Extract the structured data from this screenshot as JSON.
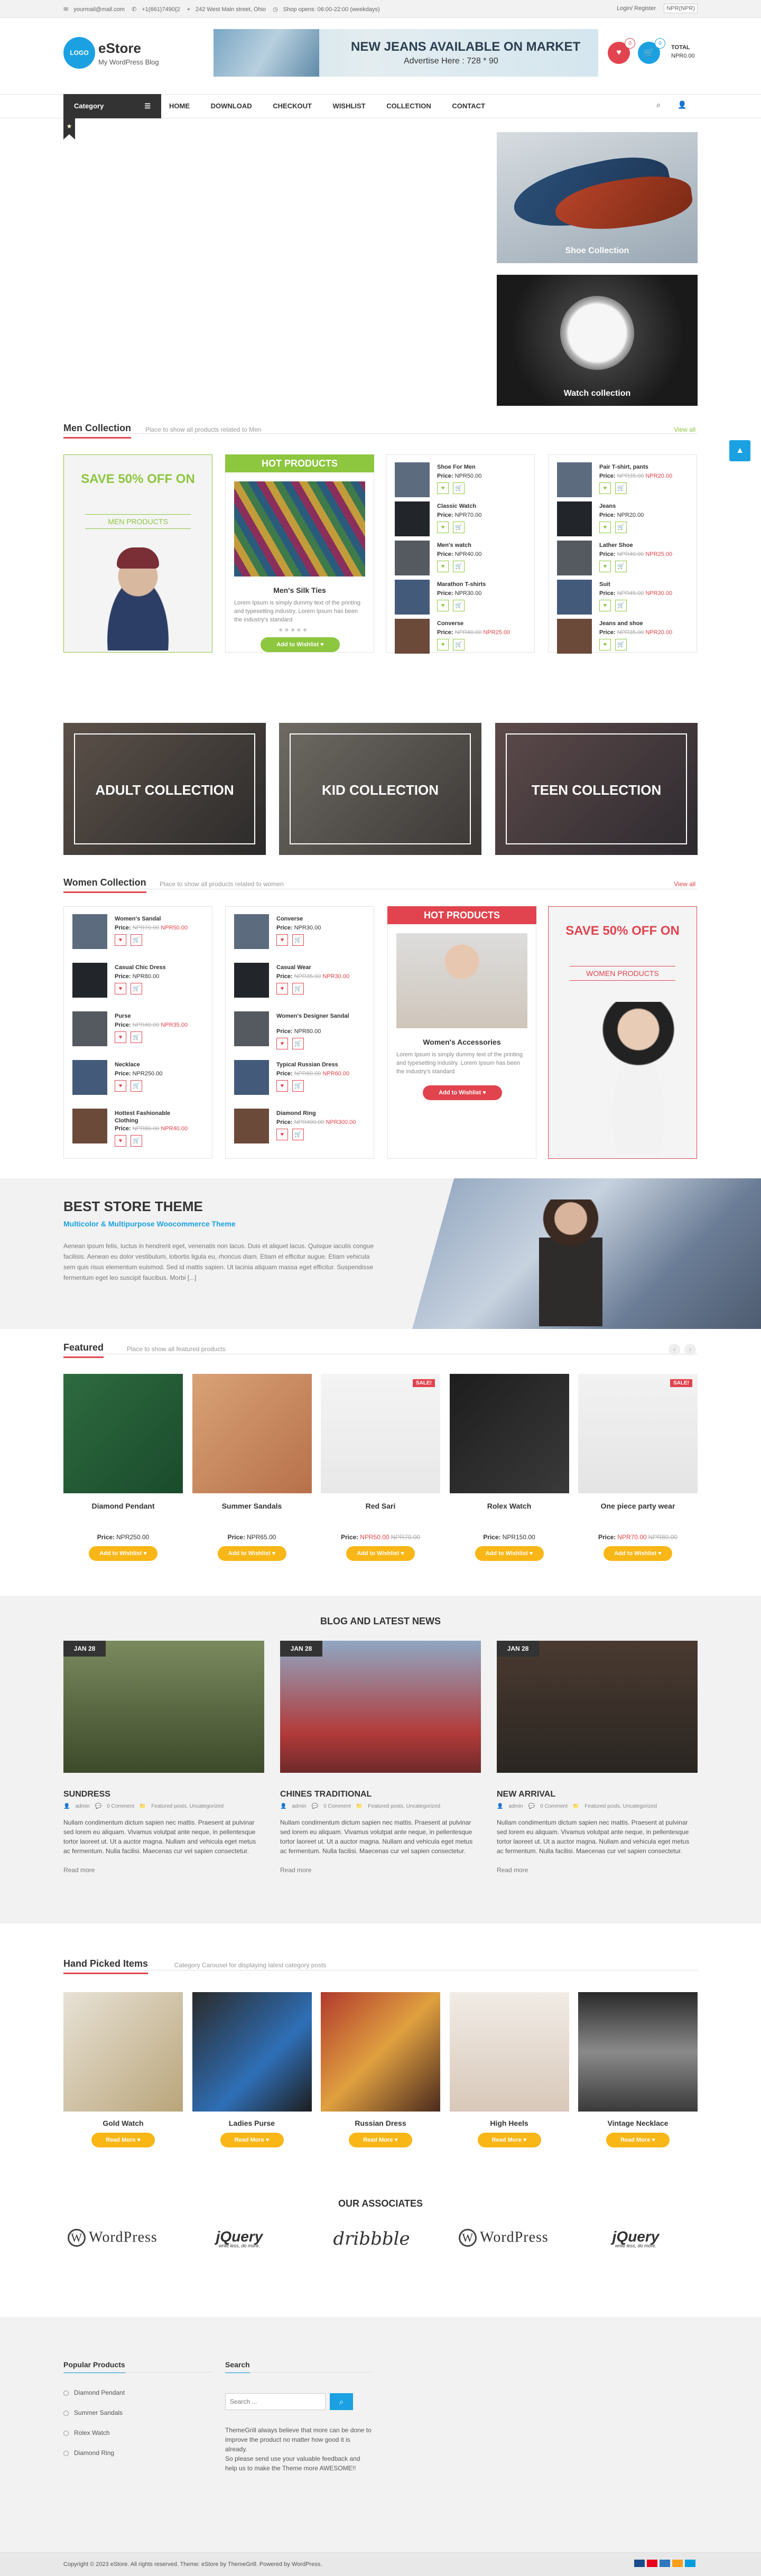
{
  "topbar": {
    "email": "yourmail@mail.com",
    "phone": "+1(661)7490{2",
    "address": "242 West Main street, Ohio",
    "hours": "Shop opens: 06:00-22:00 (weekdays)",
    "login": "Login/ Register",
    "currency": "NPR(NPR)"
  },
  "header": {
    "logo": "LOGO",
    "title": "eStore",
    "tagline": "My WordPress Blog",
    "banner_title": "NEW JEANS AVAILABLE ON MARKET",
    "banner_sub": "Advertise Here : 728 * 90",
    "wishlist_count": "0",
    "cart_count": "0",
    "total_label": "TOTAL",
    "total_value": "NPR0.00"
  },
  "nav": {
    "category": "Category",
    "items": [
      "HOME",
      "DOWNLOAD",
      "CHECKOUT",
      "WISHLIST",
      "COLLECTION",
      "CONTACT"
    ]
  },
  "promos": [
    "Shoe Collection",
    "Watch collection"
  ],
  "men": {
    "title": "Men Collection",
    "subtitle": "Place to show all products related to Men",
    "view_all": "View all",
    "sale_text": "SAVE 50% OFF ON",
    "sale_sub": "MEN PRODUCTS",
    "hot_label": "HOT PRODUCTS",
    "hot_name": "Men's Silk Ties",
    "hot_desc": "Lorem Ipsum is simply dummy text of the printing and typesetting industry. Lorem Ipsum has been the industry's standard",
    "wish_label": "Add to Wishlist",
    "price_label": "Price:",
    "col1": [
      {
        "name": "Shoe For Men",
        "price": "NPR50.00"
      },
      {
        "name": "Classic Watch",
        "price": "NPR70.00"
      },
      {
        "name": "Men's watch",
        "price": "NPR40.00"
      },
      {
        "name": "Marathon T-shirts",
        "price": "NPR30.00"
      },
      {
        "name": "Converse",
        "old": "NPR40.00",
        "price": "NPR25.00"
      }
    ],
    "col2": [
      {
        "name": "Pair T-shirt, pants",
        "old": "NPR35.00",
        "price": "NPR20.00"
      },
      {
        "name": "Jeans",
        "price": "NPR20.00"
      },
      {
        "name": "Lather Shoe",
        "old": "NPR40.00",
        "price": "NPR25.00"
      },
      {
        "name": "Suit",
        "old": "NPR45.00",
        "price": "NPR30.00"
      },
      {
        "name": "Jeans and shoe",
        "old": "NPR35.00",
        "price": "NPR20.00"
      }
    ]
  },
  "collections": [
    "ADULT COLLECTION",
    "KID COLLECTION",
    "TEEN COLLECTION"
  ],
  "women": {
    "title": "Women Collection",
    "subtitle": "Place to show all products related to women",
    "view_all": "View all",
    "hot_label": "HOT PRODUCTS",
    "hot_name": "Women's Accessories",
    "hot_desc": "Lorem Ipsum is simply dummy text of the printing and typesetting industry. Lorem Ipsum has been the industry's standard",
    "wish_label": "Add to Wishlist",
    "sale_text": "SAVE 50% OFF ON",
    "sale_sub": "WOMEN PRODUCTS",
    "col1": [
      {
        "name": "Women's Sandal",
        "old": "NPR70.00",
        "price": "NPR50.00"
      },
      {
        "name": "Casual Chic Dress",
        "price": "NPR80.00"
      },
      {
        "name": "Purse",
        "old": "NPR40.00",
        "price": "NPR35.00"
      },
      {
        "name": "Necklace",
        "price": "NPR250.00"
      },
      {
        "name": "Hottest Fashionable Clothing",
        "old": "NPR80.00",
        "price": "NPR40.00"
      }
    ],
    "col2": [
      {
        "name": "Converse",
        "price": "NPR30.00"
      },
      {
        "name": "Casual Wear",
        "old": "NPR35.00",
        "price": "NPR30.00"
      },
      {
        "name": "Women's Designer Sandal",
        "price": "NPR80.00"
      },
      {
        "name": "Typical Russian Dress",
        "old": "NPR80.00",
        "price": "NPR60.00"
      },
      {
        "name": "Diamond Ring",
        "old": "NPR400.00",
        "price": "NPR300.00"
      }
    ]
  },
  "theme_banner": {
    "title": "BEST STORE THEME",
    "subtitle": "Multicolor & Multipurpose Woocommerce Theme",
    "text": "Aenean ipsum felis, luctus in hendrerit eget, venenatis non lacus. Duis et aliquet lacus. Quisque iaculis congue facilisis. Aenean eu dolor vestibulum, lobortis ligula eu, rhoncus diam. Etiam et efficitur augue. Etiam vehicula sem quis risus elementum euismod. Sed id mattis sapien. Ut lacinia aliquam massa eget efficitur. Suspendisse fermentum eget leo suscipit faucibus. Morbi [...]"
  },
  "featured": {
    "title": "Featured",
    "subtitle": "Place to show all featured products",
    "wish_label": "Add to Wishlist",
    "sale": "SALE!",
    "items": [
      {
        "name": "Diamond Pendant",
        "price": "NPR250.00",
        "old": ""
      },
      {
        "name": "Summer Sandals",
        "price": "NPR65.00",
        "old": ""
      },
      {
        "name": "Red Sari",
        "price": "NPR50.00",
        "old": "NPR70.00"
      },
      {
        "name": "Rolex Watch",
        "price": "NPR150.00",
        "old": ""
      },
      {
        "name": "One piece party wear",
        "price": "NPR70.00",
        "old": "NPR80.00"
      }
    ]
  },
  "blog": {
    "title": "BLOG AND LATEST NEWS",
    "read_more": "Read more",
    "posts": [
      {
        "date": "JAN 28",
        "title": "SUNDRESS",
        "author": "admin",
        "comments": "0 Comment",
        "cats": "Featured posts, Uncategorized",
        "excerpt": "Nullam condimentum dictum sapien nec mattis. Praesent at pulvinar sed lorem eu aliquam. Vivamus volutpat ante neque, in pellentesque tortor laoreet ut. Ut a auctor magna. Nullam and vehicula eget metus ac fermentum. Nulla facilisi. Maecenas cur vel sapien consectetur."
      },
      {
        "date": "JAN 28",
        "title": "CHINES TRADITIONAL",
        "author": "admin",
        "comments": "0 Comment",
        "cats": "Featured posts, Uncategorized",
        "excerpt": "Nullam condimentum dictum sapien nec mattis. Praesent at pulvinar sed lorem eu aliquam. Vivamus volutpat ante neque, in pellentesque tortor laoreet ut. Ut a auctor magna. Nullam and vehicula eget metus ac fermentum. Nulla facilisi. Maecenas cur vel sapien consectetur."
      },
      {
        "date": "JAN 28",
        "title": "NEW ARRIVAL",
        "author": "admin",
        "comments": "0 Comment",
        "cats": "Featured posts, Uncategorized",
        "excerpt": "Nullam condimentum dictum sapien nec mattis. Praesent at pulvinar sed lorem eu aliquam. Vivamus volutpat ante neque, in pellentesque tortor laoreet ut. Ut a auctor magna. Nullam and vehicula eget metus ac fermentum. Nulla facilisi. Maecenas cur vel sapien consectetur."
      }
    ]
  },
  "handpicked": {
    "title": "Hand Picked Items",
    "subtitle": "Category Carousel for displaying latest category posts",
    "read_more": "Read More",
    "items": [
      "Gold Watch",
      "Ladies Purse",
      "Russian Dress",
      "High Heels",
      "Vintage Necklace"
    ]
  },
  "associates": {
    "title": "OUR ASSOCIATES",
    "logos": [
      "WordPress",
      "jQuery",
      "dribbble",
      "WordPress",
      "jQuery"
    ],
    "tagline": "write less, do more."
  },
  "footer": {
    "popular_title": "Popular Products",
    "popular": [
      "Diamond Pendant",
      "Summer Sandals",
      "Rolex Watch",
      "Diamond Ring"
    ],
    "search_title": "Search",
    "search_placeholder": "Search ...",
    "about": "ThemeGrill always believe that more can be done to improve the product no matter how good it is already.\nSo please send use your valuable feedback and help us to make the Theme more AWESOME!!",
    "copyright": "Copyright © 2023 eStore. All rights reserved. Theme: eStore by ThemeGrill. Powered by WordPress."
  },
  "colors": {
    "accent": "#1ba1e2",
    "green": "#8dc63f",
    "red": "#e1444e",
    "yellow": "#f9b617"
  }
}
